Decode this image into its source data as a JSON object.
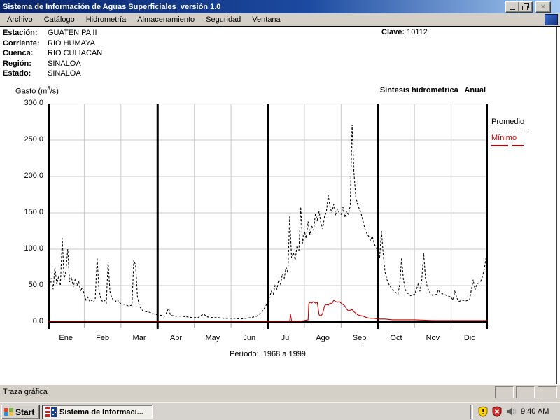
{
  "window": {
    "title": "Sistema de Información de Aguas Superficiales  versión 1.0"
  },
  "menu": {
    "items": [
      "Archivo",
      "Catálogo",
      "Hidrometría",
      "Almacenamiento",
      "Seguridad",
      "Ventana"
    ]
  },
  "station": {
    "fields": [
      {
        "label": "Estación:",
        "value": "GUATENIPA II"
      },
      {
        "label": "Corriente:",
        "value": "RIO HUMAYA"
      },
      {
        "label": "Cuenca:",
        "value": "RIO CULIACAN"
      },
      {
        "label": "Región:",
        "value": "SINALOA"
      },
      {
        "label": "Estado:",
        "value": "SINALOA"
      }
    ],
    "clave_label": "Clave:",
    "clave_value": "10112"
  },
  "chart_header": {
    "gasto_prefix": "Gasto (m",
    "gasto_sup": "3",
    "gasto_suffix": "/s)",
    "right_title": "Síntesis hidrométrica   Anual"
  },
  "legend": {
    "promedio": "Promedio",
    "minimo": "Mínimo"
  },
  "period_label": "Período:  1968 a 1999",
  "status_bar": {
    "text": "Traza gráfica"
  },
  "taskbar": {
    "start_label": "Start",
    "task_label": "Sistema de Informaci...",
    "clock": "9:40 AM"
  },
  "colors": {
    "promedio": "#000000",
    "minimo": "#c00000",
    "titlebar_left": "#0a246a",
    "titlebar_right": "#a6caf0",
    "chrome_gray": "#d4d0c8",
    "gridline": "#c9c9c9"
  },
  "chart_data": {
    "type": "line",
    "title": "Síntesis hidrométrica Anual",
    "ylabel": "Gasto (m3/s)",
    "annotation": "Período: 1968 a 1999",
    "ylim": [
      0,
      300
    ],
    "yticks": [
      300,
      250,
      200,
      150,
      100,
      50,
      0
    ],
    "ytick_labels": [
      "300.0",
      "250.0",
      "200.0",
      "150.0",
      "100.0",
      "50.0",
      "0.0"
    ],
    "months": [
      "Ene",
      "Feb",
      "Mar",
      "Abr",
      "May",
      "Jun",
      "Jul",
      "Ago",
      "Sep",
      "Oct",
      "Nov",
      "Dic"
    ],
    "x_unit": "month (0-12, daily resolution)",
    "x_range_months": [
      0,
      12
    ],
    "quarter_dividers_months": [
      0,
      3,
      6,
      9,
      12
    ],
    "grid": true,
    "legend_position": "right-outside",
    "series": [
      {
        "name": "Promedio",
        "style": "dashed",
        "color": "#000000",
        "points": [
          [
            0,
            52
          ],
          [
            0.05,
            48
          ],
          [
            0.1,
            60
          ],
          [
            0.15,
            45
          ],
          [
            0.2,
            75
          ],
          [
            0.25,
            52
          ],
          [
            0.3,
            62
          ],
          [
            0.35,
            50
          ],
          [
            0.4,
            115
          ],
          [
            0.45,
            58
          ],
          [
            0.5,
            70
          ],
          [
            0.55,
            100
          ],
          [
            0.6,
            55
          ],
          [
            0.65,
            62
          ],
          [
            0.7,
            48
          ],
          [
            0.75,
            58
          ],
          [
            0.8,
            50
          ],
          [
            0.85,
            55
          ],
          [
            0.9,
            42
          ],
          [
            0.95,
            48
          ],
          [
            1,
            38
          ],
          [
            1.05,
            30
          ],
          [
            1.1,
            34
          ],
          [
            1.15,
            28
          ],
          [
            1.2,
            30
          ],
          [
            1.25,
            27
          ],
          [
            1.3,
            32
          ],
          [
            1.35,
            88
          ],
          [
            1.4,
            45
          ],
          [
            1.45,
            32
          ],
          [
            1.5,
            28
          ],
          [
            1.55,
            30
          ],
          [
            1.6,
            26
          ],
          [
            1.65,
            83
          ],
          [
            1.7,
            42
          ],
          [
            1.75,
            33
          ],
          [
            1.8,
            30
          ],
          [
            1.85,
            28
          ],
          [
            1.9,
            31
          ],
          [
            1.95,
            27
          ],
          [
            2,
            25
          ],
          [
            2.1,
            24
          ],
          [
            2.2,
            22
          ],
          [
            2.3,
            23
          ],
          [
            2.35,
            85
          ],
          [
            2.4,
            78
          ],
          [
            2.45,
            35
          ],
          [
            2.5,
            22
          ],
          [
            2.6,
            15
          ],
          [
            2.7,
            14
          ],
          [
            2.8,
            13
          ],
          [
            2.9,
            11
          ],
          [
            3,
            10
          ],
          [
            3.1,
            9
          ],
          [
            3.2,
            8
          ],
          [
            3.3,
            19
          ],
          [
            3.35,
            9
          ],
          [
            3.5,
            8
          ],
          [
            3.65,
            8
          ],
          [
            3.8,
            7
          ],
          [
            3.95,
            6
          ],
          [
            4.1,
            6
          ],
          [
            4.25,
            11
          ],
          [
            4.35,
            7
          ],
          [
            4.5,
            6
          ],
          [
            4.65,
            6
          ],
          [
            4.8,
            5
          ],
          [
            4.95,
            5
          ],
          [
            5.1,
            5
          ],
          [
            5.25,
            4
          ],
          [
            5.4,
            5
          ],
          [
            5.55,
            6
          ],
          [
            5.7,
            8
          ],
          [
            5.85,
            14
          ],
          [
            5.95,
            22
          ],
          [
            6,
            30
          ],
          [
            6.05,
            34
          ],
          [
            6.1,
            42
          ],
          [
            6.15,
            38
          ],
          [
            6.2,
            50
          ],
          [
            6.25,
            45
          ],
          [
            6.3,
            58
          ],
          [
            6.35,
            52
          ],
          [
            6.4,
            66
          ],
          [
            6.45,
            60
          ],
          [
            6.5,
            75
          ],
          [
            6.55,
            68
          ],
          [
            6.6,
            145
          ],
          [
            6.65,
            88
          ],
          [
            6.7,
            95
          ],
          [
            6.75,
            85
          ],
          [
            6.8,
            105
          ],
          [
            6.85,
            98
          ],
          [
            6.9,
            158
          ],
          [
            6.95,
            108
          ],
          [
            7,
            125
          ],
          [
            7.05,
            115
          ],
          [
            7.1,
            138
          ],
          [
            7.15,
            120
          ],
          [
            7.2,
            132
          ],
          [
            7.25,
            126
          ],
          [
            7.3,
            148
          ],
          [
            7.35,
            140
          ],
          [
            7.4,
            152
          ],
          [
            7.45,
            136
          ],
          [
            7.5,
            128
          ],
          [
            7.55,
            145
          ],
          [
            7.6,
            152
          ],
          [
            7.65,
            174
          ],
          [
            7.7,
            158
          ],
          [
            7.75,
            150
          ],
          [
            7.8,
            162
          ],
          [
            7.85,
            148
          ],
          [
            7.9,
            155
          ],
          [
            7.95,
            150
          ],
          [
            8,
            148
          ],
          [
            8.05,
            158
          ],
          [
            8.1,
            144
          ],
          [
            8.15,
            152
          ],
          [
            8.2,
            148
          ],
          [
            8.25,
            160
          ],
          [
            8.3,
            271
          ],
          [
            8.35,
            205
          ],
          [
            8.4,
            172
          ],
          [
            8.45,
            162
          ],
          [
            8.5,
            155
          ],
          [
            8.55,
            148
          ],
          [
            8.6,
            138
          ],
          [
            8.65,
            128
          ],
          [
            8.7,
            122
          ],
          [
            8.75,
            118
          ],
          [
            8.8,
            112
          ],
          [
            8.85,
            118
          ],
          [
            8.9,
            108
          ],
          [
            8.95,
            102
          ],
          [
            9,
            98
          ],
          [
            9.05,
            88
          ],
          [
            9.1,
            125
          ],
          [
            9.15,
            92
          ],
          [
            9.2,
            68
          ],
          [
            9.25,
            58
          ],
          [
            9.3,
            52
          ],
          [
            9.35,
            48
          ],
          [
            9.4,
            44
          ],
          [
            9.5,
            40
          ],
          [
            9.55,
            38
          ],
          [
            9.6,
            52
          ],
          [
            9.65,
            88
          ],
          [
            9.7,
            58
          ],
          [
            9.75,
            44
          ],
          [
            9.8,
            40
          ],
          [
            9.9,
            36
          ],
          [
            10,
            38
          ],
          [
            10.05,
            44
          ],
          [
            10.1,
            52
          ],
          [
            10.15,
            42
          ],
          [
            10.2,
            58
          ],
          [
            10.25,
            95
          ],
          [
            10.3,
            60
          ],
          [
            10.35,
            48
          ],
          [
            10.4,
            42
          ],
          [
            10.5,
            36
          ],
          [
            10.6,
            38
          ],
          [
            10.65,
            44
          ],
          [
            10.7,
            40
          ],
          [
            10.8,
            38
          ],
          [
            10.9,
            36
          ],
          [
            11,
            34
          ],
          [
            11.05,
            30
          ],
          [
            11.1,
            42
          ],
          [
            11.15,
            34
          ],
          [
            11.2,
            28
          ],
          [
            11.3,
            30
          ],
          [
            11.4,
            29
          ],
          [
            11.5,
            30
          ],
          [
            11.6,
            58
          ],
          [
            11.65,
            44
          ],
          [
            11.7,
            52
          ],
          [
            11.8,
            55
          ],
          [
            11.85,
            62
          ],
          [
            11.9,
            72
          ],
          [
            11.95,
            88
          ],
          [
            12,
            108
          ]
        ]
      },
      {
        "name": "Mínimo",
        "style": "solid",
        "color": "#c00000",
        "points": [
          [
            0,
            1
          ],
          [
            0.5,
            1
          ],
          [
            1,
            1
          ],
          [
            1.5,
            1
          ],
          [
            2,
            1
          ],
          [
            2.5,
            1
          ],
          [
            3,
            1
          ],
          [
            3.5,
            1
          ],
          [
            4,
            1
          ],
          [
            4.5,
            1
          ],
          [
            5,
            1
          ],
          [
            5.5,
            1
          ],
          [
            6,
            1
          ],
          [
            6.3,
            1
          ],
          [
            6.6,
            1
          ],
          [
            6.62,
            11
          ],
          [
            6.65,
            1
          ],
          [
            6.9,
            1
          ],
          [
            7,
            2
          ],
          [
            7.1,
            3
          ],
          [
            7.12,
            25
          ],
          [
            7.15,
            27
          ],
          [
            7.2,
            26
          ],
          [
            7.25,
            28
          ],
          [
            7.3,
            26
          ],
          [
            7.35,
            27
          ],
          [
            7.4,
            10
          ],
          [
            7.45,
            8
          ],
          [
            7.5,
            12
          ],
          [
            7.55,
            22
          ],
          [
            7.6,
            24
          ],
          [
            7.65,
            23
          ],
          [
            7.7,
            26
          ],
          [
            7.75,
            25
          ],
          [
            7.8,
            30
          ],
          [
            7.85,
            28
          ],
          [
            7.9,
            27
          ],
          [
            7.95,
            28
          ],
          [
            8,
            26
          ],
          [
            8.05,
            24
          ],
          [
            8.1,
            22
          ],
          [
            8.15,
            18
          ],
          [
            8.2,
            15
          ],
          [
            8.25,
            16
          ],
          [
            8.3,
            17
          ],
          [
            8.35,
            14
          ],
          [
            8.4,
            12
          ],
          [
            8.45,
            10
          ],
          [
            8.5,
            9
          ],
          [
            8.6,
            8
          ],
          [
            8.7,
            6
          ],
          [
            8.8,
            5
          ],
          [
            8.9,
            5
          ],
          [
            9,
            4
          ],
          [
            9.2,
            4
          ],
          [
            9.4,
            3
          ],
          [
            9.6,
            3
          ],
          [
            9.8,
            3
          ],
          [
            10,
            3
          ],
          [
            10.5,
            2
          ],
          [
            11,
            2
          ],
          [
            11.5,
            2
          ],
          [
            12,
            2
          ]
        ]
      }
    ]
  }
}
